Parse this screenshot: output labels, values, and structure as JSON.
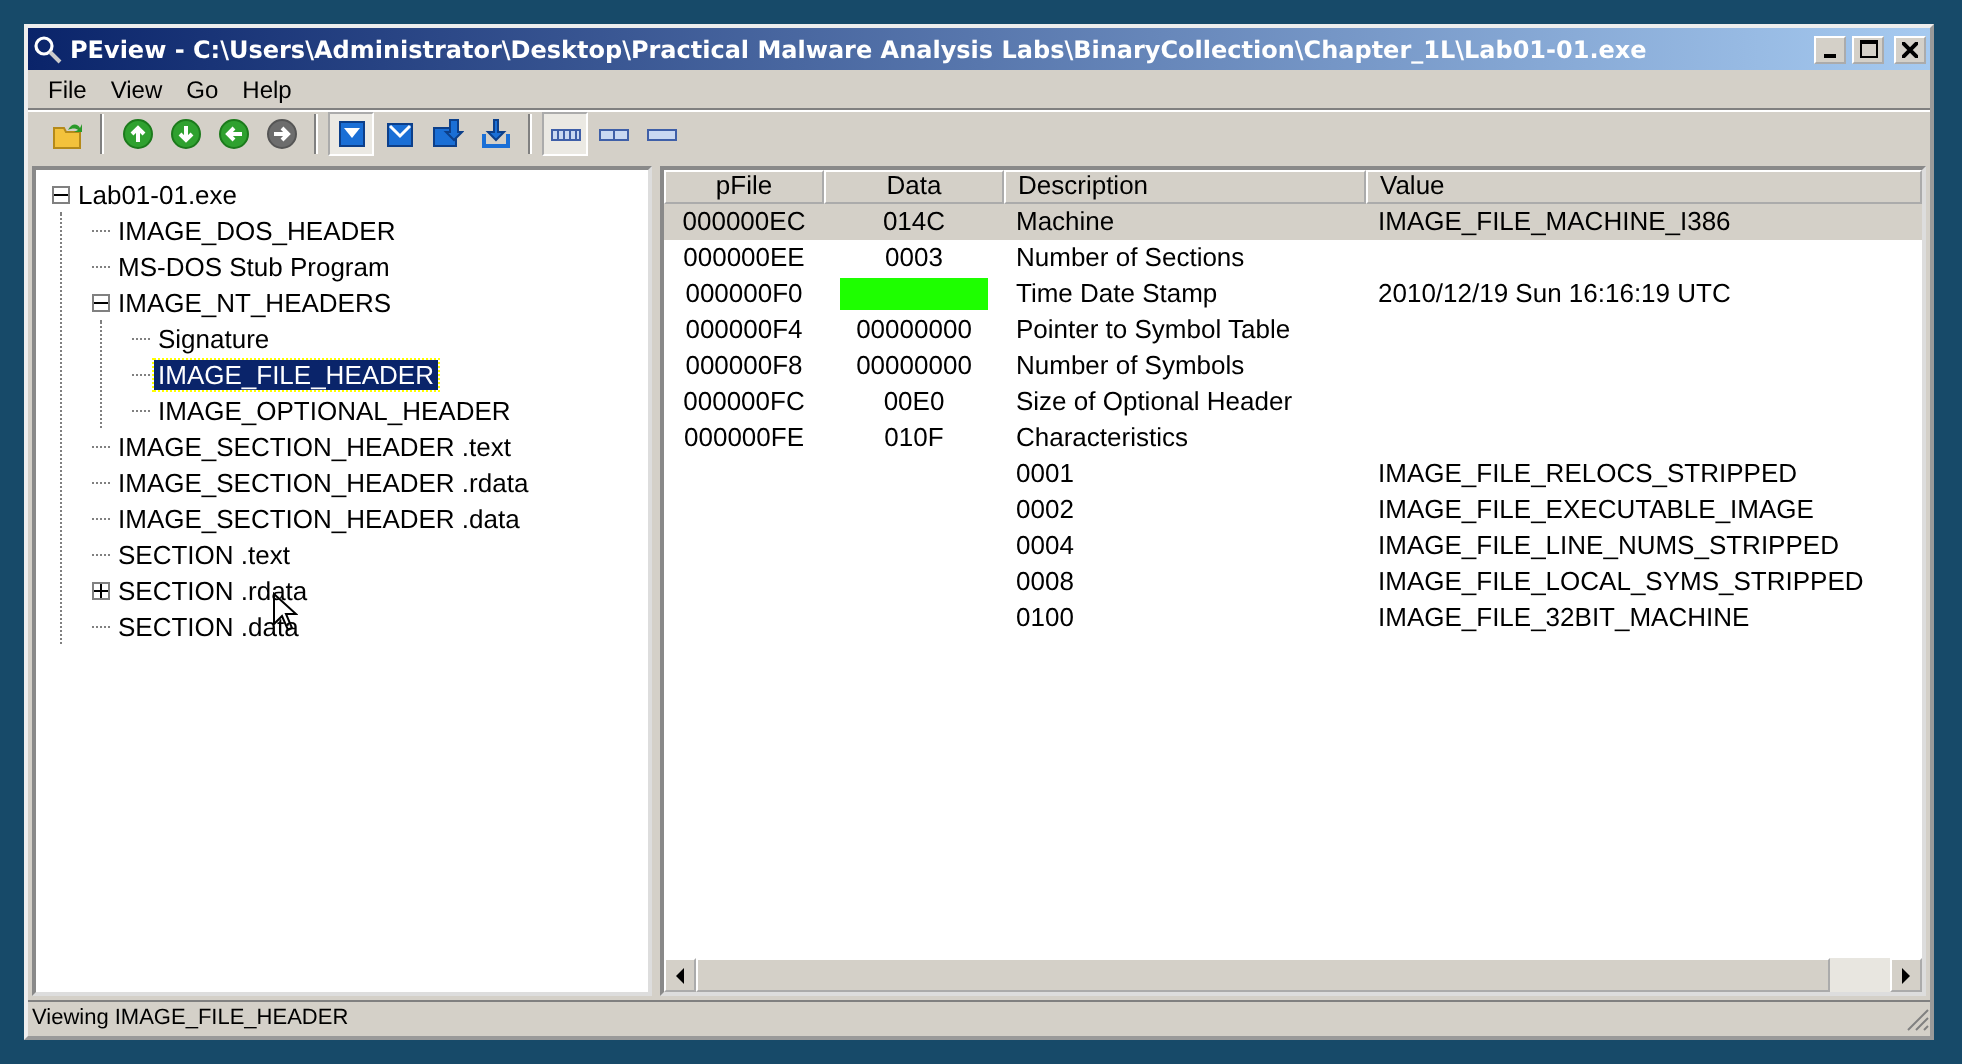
{
  "window": {
    "title": "PEview - C:\\Users\\Administrator\\Desktop\\Practical Malware Analysis Labs\\BinaryCollection\\Chapter_1L\\Lab01-01.exe"
  },
  "menu": [
    "File",
    "View",
    "Go",
    "Help"
  ],
  "toolbar": [
    {
      "kind": "open",
      "pressed": false,
      "disabled": false
    },
    {
      "kind": "sep"
    },
    {
      "kind": "up",
      "pressed": false,
      "disabled": false
    },
    {
      "kind": "down",
      "pressed": false,
      "disabled": false
    },
    {
      "kind": "back",
      "pressed": false,
      "disabled": false
    },
    {
      "kind": "forward",
      "pressed": false,
      "disabled": true
    },
    {
      "kind": "sep"
    },
    {
      "kind": "box-arrow",
      "pressed": true,
      "disabled": false
    },
    {
      "kind": "envelope",
      "pressed": false,
      "disabled": false
    },
    {
      "kind": "box-arrow-small",
      "pressed": false,
      "disabled": false
    },
    {
      "kind": "arrow-bracket",
      "pressed": false,
      "disabled": false
    },
    {
      "kind": "sep"
    },
    {
      "kind": "bar-4",
      "pressed": true,
      "disabled": false
    },
    {
      "kind": "bar-2",
      "pressed": false,
      "disabled": false
    },
    {
      "kind": "bar-1",
      "pressed": false,
      "disabled": false
    }
  ],
  "tree": [
    {
      "label": "Lab01-01.exe",
      "selected": false,
      "expanded": true,
      "children": [
        {
          "label": "IMAGE_DOS_HEADER",
          "selected": false
        },
        {
          "label": "MS-DOS Stub Program",
          "selected": false
        },
        {
          "label": "IMAGE_NT_HEADERS",
          "selected": false,
          "expanded": true,
          "children": [
            {
              "label": "Signature",
              "selected": false
            },
            {
              "label": "IMAGE_FILE_HEADER",
              "selected": true
            },
            {
              "label": "IMAGE_OPTIONAL_HEADER",
              "selected": false
            }
          ]
        },
        {
          "label": "IMAGE_SECTION_HEADER .text",
          "selected": false
        },
        {
          "label": "IMAGE_SECTION_HEADER .rdata",
          "selected": false
        },
        {
          "label": "IMAGE_SECTION_HEADER .data",
          "selected": false
        },
        {
          "label": "SECTION .text",
          "selected": false
        },
        {
          "label": "SECTION .rdata",
          "selected": false,
          "expanded": false
        },
        {
          "label": "SECTION .data",
          "selected": false
        }
      ]
    }
  ],
  "table": {
    "columns": [
      "pFile",
      "Data",
      "Description",
      "Value"
    ],
    "rows": [
      {
        "pfile": "000000EC",
        "data": "014C",
        "description": "Machine",
        "value": "IMAGE_FILE_MACHINE_I386",
        "selected": true
      },
      {
        "pfile": "000000EE",
        "data": "0003",
        "description": "Number of Sections",
        "selected": false
      },
      {
        "pfile": "000000F0",
        "data_covered": true,
        "description": "Time Date Stamp",
        "value": "2010/12/19 Sun 16:16:19 UTC",
        "selected": false
      },
      {
        "pfile": "000000F4",
        "data": "00000000",
        "description": "Pointer to Symbol Table",
        "selected": false
      },
      {
        "pfile": "000000F8",
        "data": "00000000",
        "description": "Number of Symbols",
        "selected": false
      },
      {
        "pfile": "000000FC",
        "data": "00E0",
        "description": "Size of Optional Header",
        "selected": false
      },
      {
        "pfile": "000000FE",
        "data": "010F",
        "description": "Characteristics",
        "selected": false
      },
      {
        "description": "0001",
        "value": "IMAGE_FILE_RELOCS_STRIPPED",
        "selected": false
      },
      {
        "description": "0002",
        "value": "IMAGE_FILE_EXECUTABLE_IMAGE",
        "selected": false
      },
      {
        "description": "0004",
        "value": "IMAGE_FILE_LINE_NUMS_STRIPPED",
        "selected": false
      },
      {
        "description": "0008",
        "value": "IMAGE_FILE_LOCAL_SYMS_STRIPPED",
        "selected": false
      },
      {
        "description": "0100",
        "value": "IMAGE_FILE_32BIT_MACHINE",
        "selected": false
      }
    ]
  },
  "status_bar": "Viewing IMAGE_FILE_HEADER"
}
